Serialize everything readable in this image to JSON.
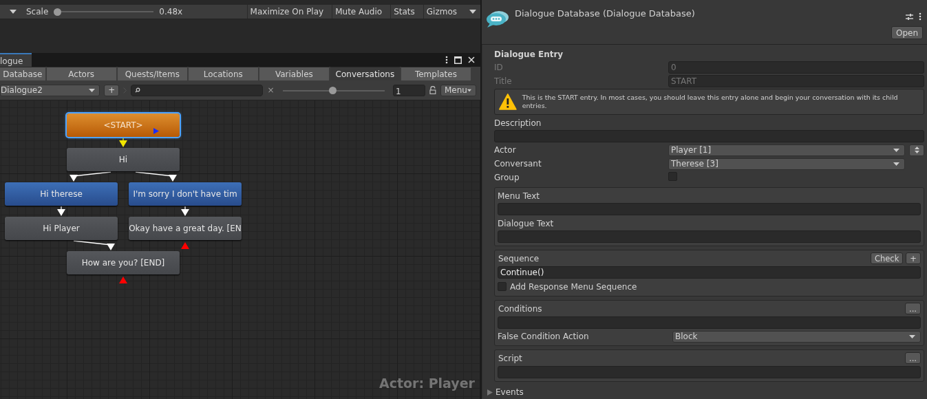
{
  "game_toolbar": {
    "scale_label": "Scale",
    "scale": {
      "level": 0.0
    },
    "scale_value": "0.48x",
    "buttons": [
      "Maximize On Play",
      "Mute Audio",
      "Stats",
      "Gizmos"
    ]
  },
  "dialogue_window": {
    "tab": "logue",
    "tabs": [
      {
        "label": "Database",
        "selected": false
      },
      {
        "label": "Actors",
        "selected": false
      },
      {
        "label": "Quests/Items",
        "selected": false
      },
      {
        "label": "Locations",
        "selected": false
      },
      {
        "label": "Variables",
        "selected": false
      },
      {
        "label": "Conversations",
        "selected": true
      },
      {
        "label": "Templates",
        "selected": false
      }
    ],
    "conversation": "Dialogue2",
    "add_button": "+",
    "clear": "×",
    "zoom": {
      "level": 0.49
    },
    "zoom_value": "1",
    "menu": "Menu"
  },
  "graph": {
    "nodes": [
      {
        "text": "<START>",
        "kind": "start",
        "selected": true,
        "end": false
      },
      {
        "text": "Hi",
        "kind": "npc",
        "selected": false,
        "end": false
      },
      {
        "text": "Hi therese",
        "kind": "player",
        "selected": false,
        "end": false
      },
      {
        "text": "I'm sorry I don't have tim",
        "kind": "player",
        "selected": false,
        "end": false
      },
      {
        "text": "Hi Player",
        "kind": "npc",
        "selected": false,
        "end": false
      },
      {
        "text": "Okay have a great day. [EN",
        "kind": "npc",
        "selected": false,
        "end": true
      },
      {
        "text": "How are you? [END]",
        "kind": "npc",
        "selected": false,
        "end": true
      }
    ],
    "caption": "Actor: Player"
  },
  "inspector": {
    "title": "Dialogue Database (Dialogue Database)",
    "open_button": "Open",
    "section": "Dialogue Entry",
    "id": {
      "label": "ID",
      "value": "0",
      "disabled": true
    },
    "entry_title": {
      "label": "Title",
      "value": "START",
      "disabled": true
    },
    "warning": "This is the START entry. In most cases, you should leave this entry alone and begin your conversation with its child entries.",
    "description": {
      "label": "Description"
    },
    "actor": {
      "label": "Actor",
      "value": "Player [1]"
    },
    "conversant": {
      "label": "Conversant",
      "value": "Therese [3]"
    },
    "group": {
      "label": "Group",
      "checked": false
    },
    "menu_text": {
      "label": "Menu Text"
    },
    "dialogue_text": {
      "label": "Dialogue Text"
    },
    "sequence": {
      "label": "Sequence",
      "value": "Continue()",
      "check_button": "Check",
      "add_button": "+",
      "response": {
        "label": "Add Response Menu Sequence",
        "checked": false
      }
    },
    "conditions": {
      "label": "Conditions",
      "button": "...",
      "false_action": {
        "label": "False Condition Action",
        "value": "Block"
      }
    },
    "script": {
      "label": "Script",
      "button": "..."
    },
    "events": {
      "label": "Events",
      "expanded": false
    }
  }
}
